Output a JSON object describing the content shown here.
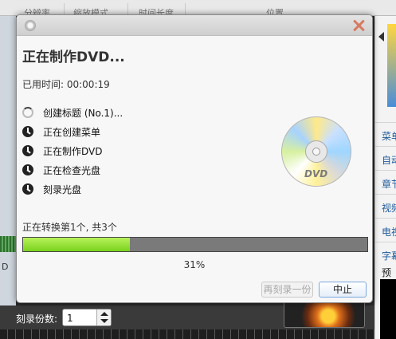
{
  "background": {
    "columns": [
      "分辨率",
      "缩放模式",
      "时间长度",
      "位置"
    ],
    "right_panel": {
      "menu_items": [
        "菜单",
        "自动",
        "章节",
        "视频",
        "电视",
        "字幕"
      ],
      "preview_label": "预览"
    },
    "left_strip_text": "D",
    "copies": {
      "label": "刻录份数:",
      "value": "1"
    }
  },
  "dialog": {
    "heading": "正在制作DVD...",
    "elapsed": {
      "label": "已用时间: ",
      "value": "00:00:19"
    },
    "steps": [
      {
        "icon": "spinner-icon",
        "label": "创建标题 (No.1)..."
      },
      {
        "icon": "clock-icon",
        "label": "正在创建菜单"
      },
      {
        "icon": "clock-icon",
        "label": "正在制作DVD"
      },
      {
        "icon": "clock-icon",
        "label": "正在检查光盘"
      },
      {
        "icon": "clock-icon",
        "label": "刻录光盘"
      }
    ],
    "disc_logo": "DVD",
    "status": "正在转换第1个, 共3个",
    "progress": {
      "percent_value": 31,
      "text": "31%"
    },
    "buttons": {
      "reburn": "再刻录一份",
      "stop": "中止"
    },
    "colors": {
      "progress_fill": "#8fdc2c",
      "progress_track": "#7a7a7a",
      "close": "#d77a5f"
    }
  }
}
